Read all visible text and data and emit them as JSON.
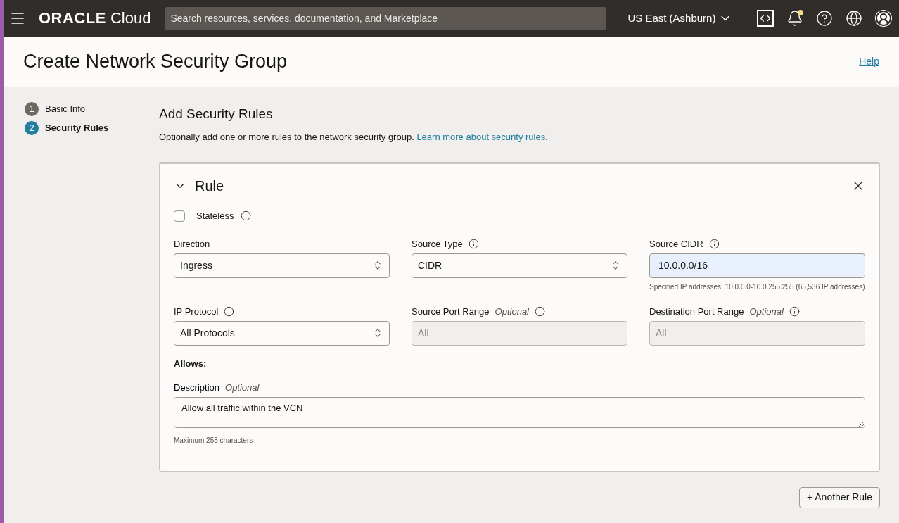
{
  "header": {
    "logo_brand": "ORACLE",
    "logo_product": "Cloud",
    "search": {
      "placeholder": "Search resources, services, documentation, and Marketplace"
    },
    "region": "US East (Ashburn)",
    "notification_unread": true
  },
  "page": {
    "title": "Create Network Security Group",
    "help_link": "Help"
  },
  "steps": [
    {
      "number": "1",
      "label": "Basic Info",
      "selected": false
    },
    {
      "number": "2",
      "label": "Security Rules",
      "selected": true
    }
  ],
  "section": {
    "title": "Add Security Rules",
    "intro": "Optionally add one or more rules to the network security group.",
    "intro_link": "Learn more about security rules",
    "intro_end": "."
  },
  "rule": {
    "title": "Rule",
    "expanded": true,
    "stateless": {
      "label": "Stateless",
      "checked": false,
      "info": true
    },
    "fields": [
      {
        "kind": "select",
        "label": "Direction",
        "info": false,
        "value": "Ingress"
      },
      {
        "kind": "select",
        "label": "Source Type",
        "info": true,
        "value": "CIDR"
      },
      {
        "kind": "text",
        "label": "Source CIDR",
        "info": true,
        "value": "10.0.0.0/16",
        "autofilled": true,
        "help": "Specified IP addresses: 10.0.0.0-10.0.255.255 (65,536 IP addresses)"
      },
      {
        "kind": "select",
        "label": "IP Protocol",
        "info": true,
        "value": "All Protocols"
      },
      {
        "kind": "disabled",
        "label": "Source Port Range",
        "optional": "Optional",
        "info": true,
        "value": "All"
      },
      {
        "kind": "disabled",
        "label": "Destination Port Range",
        "optional": "Optional",
        "info": true,
        "value": "All"
      }
    ],
    "allows_label": "Allows:",
    "description": {
      "label": "Description",
      "optional": "Optional",
      "value": "Allow all traffic within the VCN",
      "help": "Maximum 255 characters"
    }
  },
  "another_rule_button": "+ Another Rule"
}
